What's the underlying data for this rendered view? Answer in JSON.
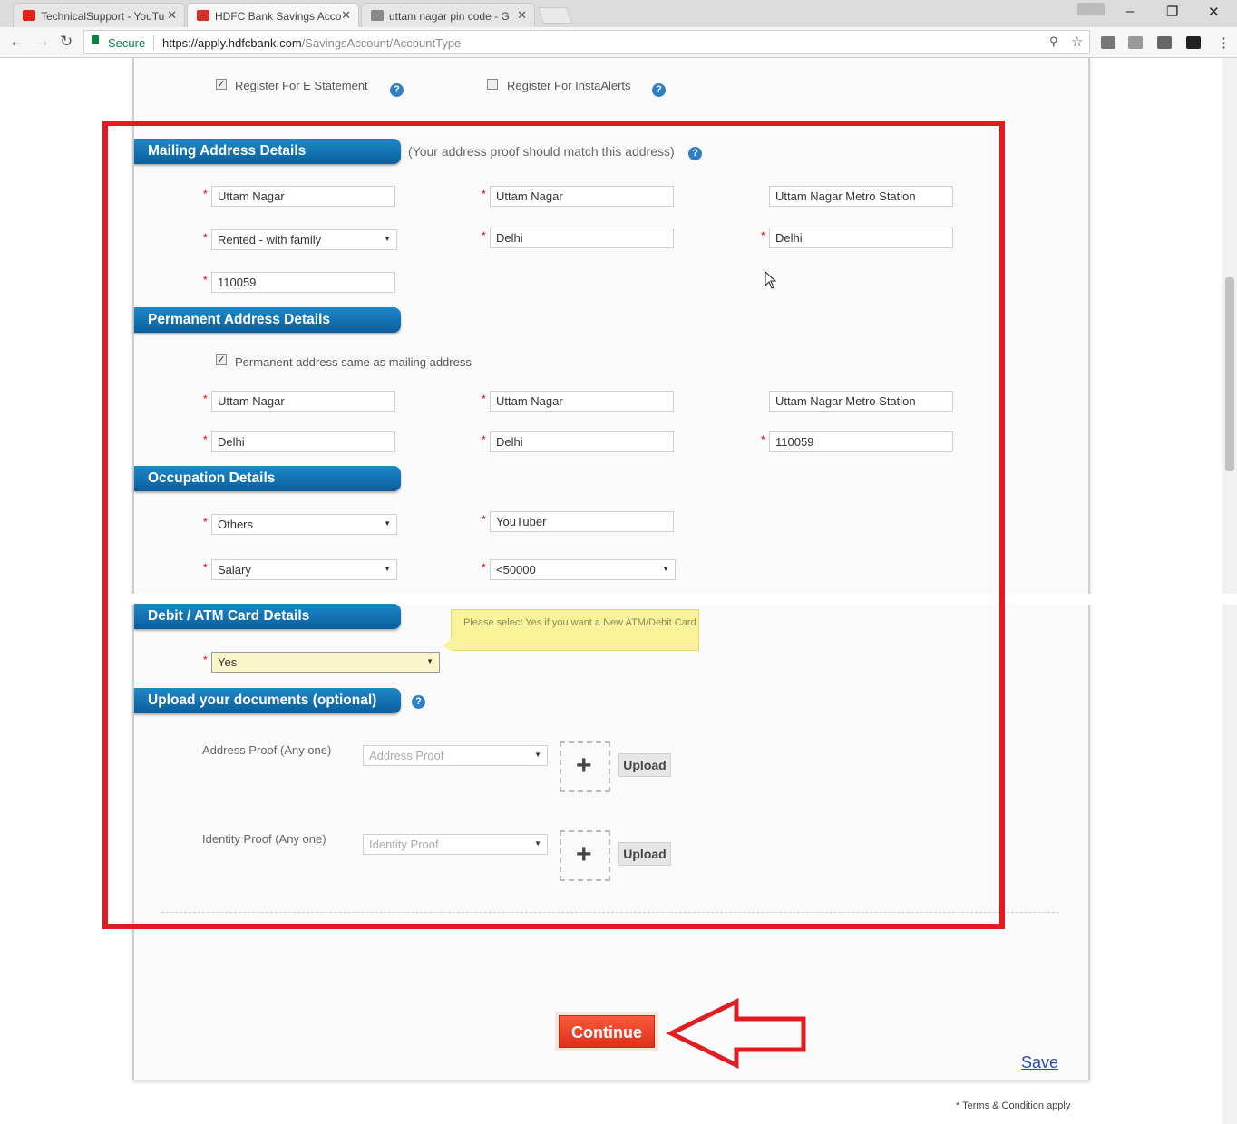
{
  "browser": {
    "tabs": [
      {
        "title": "TechnicalSupport - YouTu",
        "favicon_color": "#e62117"
      },
      {
        "title": "HDFC Bank Savings Acco",
        "favicon_color": "#d32f2f"
      },
      {
        "title": "uttam nagar pin code - G",
        "favicon_color": "#888888"
      }
    ],
    "secure_label": "Secure",
    "url_host": "https://apply.hdfcbank.com",
    "url_path": "/SavingsAccount/AccountType",
    "window_controls": {
      "minimize": "–",
      "restore": "❐",
      "close": "✕"
    },
    "nav": {
      "back": "←",
      "forward": "→",
      "reload": "↻"
    },
    "tab_close": "✕"
  },
  "registration": {
    "e_statement": {
      "label": "Register For E Statement",
      "checked": true
    },
    "insta_alerts": {
      "label": "Register For InstaAlerts",
      "checked": false
    }
  },
  "mailing": {
    "title": "Mailing Address Details",
    "note": "(Your address proof should match this address)",
    "address1": "Uttam Nagar",
    "address2": "Uttam Nagar",
    "landmark": "Uttam Nagar Metro Station",
    "residence_type": "Rented - with family",
    "city": "Delhi",
    "state": "Delhi",
    "pincode": "110059"
  },
  "permanent": {
    "title": "Permanent Address Details",
    "same_as_mailing_label": "Permanent address same as mailing address",
    "same_as_mailing_checked": true,
    "address1": "Uttam Nagar",
    "address2": "Uttam Nagar",
    "landmark": "Uttam Nagar Metro Station",
    "city": "Delhi",
    "state": "Delhi",
    "pincode": "110059"
  },
  "occupation": {
    "title": "Occupation Details",
    "type": "Others",
    "detail": "YouTuber",
    "income_source": "Salary",
    "income_range": "<50000"
  },
  "card": {
    "title": "Debit / ATM Card Details",
    "value": "Yes",
    "tooltip": "Please select Yes if you want a New ATM/Debit Card"
  },
  "documents": {
    "title": "Upload your documents (optional)",
    "address_label": "Address Proof (Any one)",
    "address_placeholder": "Address Proof",
    "identity_label": "Identity Proof (Any one)",
    "identity_placeholder": "Identity Proof",
    "upload_label": "Upload",
    "plus": "+"
  },
  "actions": {
    "continue_label": "Continue",
    "save_label": "Save",
    "terms": "* Terms & Condition apply"
  },
  "help_glyph": "?",
  "required_mark": "*",
  "colors": {
    "highlight": "#e21b23",
    "section_header": "#0b5e9c",
    "continue_button": "#e8391f",
    "tooltip_bg": "#faf39a"
  }
}
